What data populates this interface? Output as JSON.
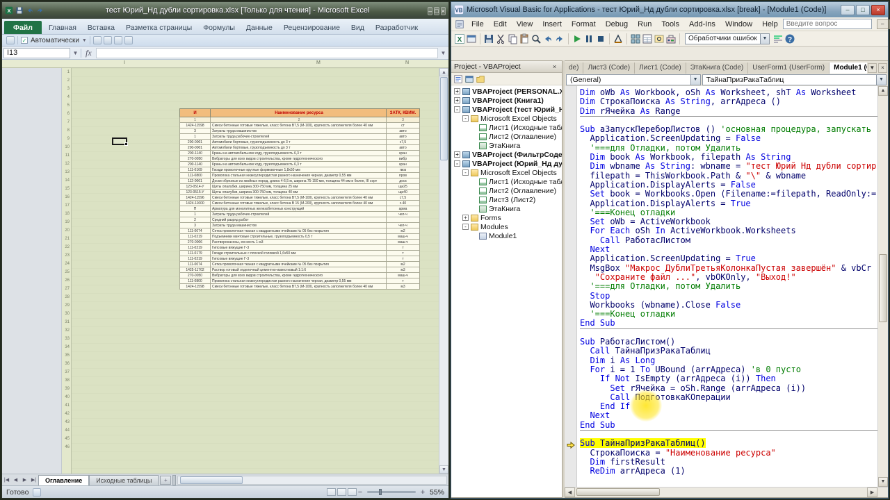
{
  "colors": {
    "excel_file_tab": "#217346",
    "sheet_fill": "#dbe2c3",
    "table_header_fill": "#f2bd7e",
    "table_header_text": "#c00000",
    "vba_keyword": "#0000e0",
    "vba_comment": "#007c00",
    "vba_string": "#cc0000",
    "vba_normal": "#00006b",
    "execution_highlight": "#ffff00"
  },
  "excel": {
    "window_title": "тест Юрий_Нд дубли сортировка.xlsx  [Только для чтения] - Microsoft Excel",
    "quick_access_icons": [
      "excel-logo-icon",
      "save-icon",
      "undo-icon",
      "redo-icon"
    ],
    "window_buttons": [
      "minimize-icon",
      "maximize-icon",
      "close-icon"
    ],
    "ribbon_tabs": [
      {
        "label": "Файл",
        "file": true
      },
      {
        "label": "Главная"
      },
      {
        "label": "Вставка"
      },
      {
        "label": "Разметка страницы"
      },
      {
        "label": "Формулы"
      },
      {
        "label": "Данные"
      },
      {
        "label": "Рецензирование"
      },
      {
        "label": "Вид"
      },
      {
        "label": "Разработчик"
      }
    ],
    "ribbon_bar": {
      "checkbox_label": "Автоматически",
      "icons": [
        "calc-options-icon",
        "grid-icon",
        "trace-icon",
        "watch-icon"
      ]
    },
    "formula_bar": {
      "name_box": "I13",
      "fx_label": "fx",
      "formula_value": ""
    },
    "grid": {
      "column_letters": [
        "I",
        "M",
        "N"
      ],
      "row_number_count": 46,
      "selection_cell": "I13"
    },
    "table": {
      "header": [
        "И",
        "Наименование ресурса",
        "ЗАТК, КВИМ."
      ],
      "subheader": [
        "1",
        "2",
        "3"
      ],
      "rows": [
        [
          "1424-11598",
          "Смеси бетонные готовые тяжелые, класс бетона В7,5 (М-100), крупность заполнителя более 40 мм",
          "ст"
        ],
        [
          "3",
          "Затраты труда машинистов",
          "авто"
        ],
        [
          "1",
          "Затраты труда рабочих-строителей",
          "авто"
        ],
        [
          "200-0001",
          "Автомобили бортовые, грузоподъемность до 3 т",
          "с7,5"
        ],
        [
          "200-0001",
          "Автомобили бортовые, грузоподъемность до 3 т",
          "авто"
        ],
        [
          "200-1140",
          "Краны на автомобильном ходу, грузоподъемность 6,3 т",
          "кран"
        ],
        [
          "270-0050",
          "Вибраторы для всех видов строительства, кроме гидротехнического",
          "вибр"
        ],
        [
          "200-1140",
          "Краны на автомобильном ходу, грузоподъемность 6,3 т",
          "кран"
        ],
        [
          "111-0169",
          "Гвозди проволочные круглые формовочные 1,8х50 мм",
          "гвоз"
        ],
        [
          "111-0800",
          "Проволока стальная низкоуглеродистая разного назначения черная, диаметр 0,55 мм",
          "пров"
        ],
        [
          "112-0061",
          "Доски обрезные из хвойных пород, длина 4-6,5 м, ширина 75-150 мм, толщина 44 мм и более, III сорт",
          "доск"
        ],
        [
          "123-0514-У",
          "Щиты опалубки, ширина 300-750 мм, толщина 25 мм",
          "щи25"
        ],
        [
          "123-0515-У",
          "Щиты опалубки, ширина 300-750 мм, толщина 40 мм",
          "щи40"
        ],
        [
          "1424-11596",
          "Смеси бетонные готовые тяжелые, класс бетона В7,5 (М-100), крупность заполнителя более 40 мм",
          "с7,5"
        ],
        [
          "1424-11600",
          "Смеси бетонные готовые тяжелые, класс бетона В 15 (М-200), крупность заполнителя более 40 мм",
          "с.40"
        ],
        [
          "П",
          "Арматура для монолитных железобетонных конструкций",
          "арма"
        ],
        [
          "1",
          "Затраты труда рабочих-строителей",
          "чел-ч"
        ],
        [
          "2",
          "Средний разряд работ",
          ""
        ],
        [
          "3",
          "Затраты труда машинистов",
          "чел-ч"
        ],
        [
          "111-0074",
          "Сетка проволочная тканая с квадратными ячейками № 05 без покрытия",
          "м2"
        ],
        [
          "111-0219",
          "Подъемники мачтовые строительные, грузоподъемность 0,5 т",
          "маш-ч"
        ],
        [
          "270-0006",
          "Растворонасосы, ем-кость 1 м3",
          "маш-ч"
        ],
        [
          "111-0219",
          "Гипсовые вяжущие Г-3",
          "т"
        ],
        [
          "111-0179",
          "Гвозди строительные с плоской головкой 1,6х50 мм",
          "т"
        ],
        [
          "111-0219",
          "Гипсовые вяжущие Г-3",
          "т"
        ],
        [
          "111-0074",
          "Сетка проволочная тканая с квадратными ячейками № 05 без покрытия",
          "м2"
        ],
        [
          "1425-11702",
          "Раствор готовый отделочный цементно-известковый 1:1:6",
          "м3"
        ],
        [
          "270-0050",
          "Вибраторы для всех видов строительства, кроме гидротехнического",
          "маш-ч"
        ],
        [
          "111-0800",
          "Проволока стальная низкоуглеродистая разного назначения черная, диаметр 0,55 мм",
          "т"
        ],
        [
          "1424-11598",
          "Смеси бетонные готовые тяжелые, класс бетона В7,5 (М-100), крупность заполнителя более 40 мм",
          "м3"
        ]
      ]
    },
    "sheet_tabs": [
      {
        "label": "Оглавление",
        "active": true
      },
      {
        "label": "Исходные таблицы",
        "active": false
      }
    ],
    "status_bar": {
      "mode": "Готово",
      "zoom": "55%",
      "view_icons": [
        "normal-view-icon",
        "page-layout-view-icon",
        "page-break-view-icon"
      ]
    }
  },
  "vba": {
    "window_title": "Microsoft Visual Basic for Applications - тест Юрий_Нд дубли сортировка.xlsx [break] - [Module1 (Code)]",
    "menus": [
      "File",
      "Edit",
      "View",
      "Insert",
      "Format",
      "Debug",
      "Run",
      "Tools",
      "Add-Ins",
      "Window",
      "Help"
    ],
    "question_box": "Введите вопрос",
    "window_buttons": [
      "minimize-icon",
      "restore-icon",
      "close-icon"
    ],
    "toolbar": {
      "icons_left": [
        "excel-view-icon",
        "insert-userform-icon",
        "save-icon",
        "cut-icon",
        "copy-icon",
        "paste-icon",
        "find-icon",
        "undo-icon",
        "redo-icon",
        "run-icon",
        "break-icon",
        "reset-icon",
        "design-mode-icon",
        "project-explorer-icon",
        "properties-window-icon",
        "object-browser-icon",
        "toolbox-icon"
      ],
      "combo_value": "Обработчики ошибок",
      "icons_right": [
        "comment-block-icon",
        "help-icon"
      ]
    },
    "project_panel": {
      "title": "Project - VBAProject",
      "toolbar_icons": [
        "view-code-icon",
        "view-object-icon",
        "toggle-folders-icon"
      ],
      "tree": [
        {
          "label": "VBAProject (PERSONAL.XLSB)",
          "level": 0,
          "bold": true,
          "icon": "project-icon",
          "exp": "+"
        },
        {
          "label": "VBAProject (Книга1)",
          "level": 0,
          "bold": true,
          "icon": "project-icon",
          "exp": "+"
        },
        {
          "label": "VBAProject (тест Юрий_Нд д",
          "level": 0,
          "bold": true,
          "icon": "project-icon",
          "exp": "-"
        },
        {
          "label": "Microsoft Excel Objects",
          "level": 1,
          "icon": "folder-icon",
          "exp": "-"
        },
        {
          "label": "Лист1 (Исходные таблиц",
          "level": 2,
          "icon": "sheet-icon"
        },
        {
          "label": "Лист2 (Оглавление)",
          "level": 2,
          "icon": "sheet-icon"
        },
        {
          "label": "ЭтаКнига",
          "level": 2,
          "icon": "workbook-icon"
        },
        {
          "label": "VBAProject (ФильтрСодержи",
          "level": 0,
          "bold": true,
          "icon": "project-icon",
          "exp": "+"
        },
        {
          "label": "VBAProject (Юрий_Нд дубли",
          "level": 0,
          "bold": true,
          "icon": "project-icon",
          "exp": "-"
        },
        {
          "label": "Microsoft Excel Objects",
          "level": 1,
          "icon": "folder-icon",
          "exp": "-"
        },
        {
          "label": "Лист1 (Исходные таблицы)",
          "level": 2,
          "icon": "sheet-icon"
        },
        {
          "label": "Лист2 (Оглавление)",
          "level": 2,
          "icon": "sheet-icon"
        },
        {
          "label": "Лист3 (Лист2)",
          "level": 2,
          "icon": "sheet-icon"
        },
        {
          "label": "ЭтаКнига",
          "level": 2,
          "icon": "workbook-icon"
        },
        {
          "label": "Forms",
          "level": 1,
          "icon": "folder-icon",
          "exp": "+"
        },
        {
          "label": "Modules",
          "level": 1,
          "icon": "folder-icon",
          "exp": "-"
        },
        {
          "label": "Module1",
          "level": 2,
          "icon": "module-icon"
        }
      ]
    },
    "code_window": {
      "tabs": [
        {
          "label": "de)"
        },
        {
          "label": "Лист3 (Code)"
        },
        {
          "label": "Лист1 (Code)"
        },
        {
          "label": "ЭтаКнига (Code)"
        },
        {
          "label": "UserForm1 (UserForm)"
        },
        {
          "label": "Module1 (Code)",
          "active": true
        }
      ],
      "object_combo": "(General)",
      "procedure_combo": "ТайнаПризРакаТаблиц",
      "lines": [
        {
          "s": [
            [
              "k",
              "Dim "
            ],
            [
              "n",
              "oWb "
            ],
            [
              "k",
              "As "
            ],
            [
              "n",
              "Workbook, oSh "
            ],
            [
              "k",
              "As "
            ],
            [
              "n",
              "Worksheet, shT "
            ],
            [
              "k",
              "As "
            ],
            [
              "n",
              "Worksheet"
            ]
          ]
        },
        {
          "s": [
            [
              "k",
              "Dim "
            ],
            [
              "n",
              "СтрокаПоиска "
            ],
            [
              "k",
              "As String"
            ],
            [
              "n",
              ", arrАдреса ()"
            ]
          ]
        },
        {
          "s": [
            [
              "k",
              "Dim "
            ],
            [
              "n",
              "rЯчейка "
            ],
            [
              "k",
              "As "
            ],
            [
              "n",
              "Range"
            ]
          ]
        },
        {
          "sep": true,
          "s": []
        },
        {
          "s": [
            [
              "k",
              "Sub "
            ],
            [
              "n",
              "аЗапускПереборЛистов () "
            ],
            [
              "c",
              "'основная процедура, запускать"
            ]
          ]
        },
        {
          "s": [
            [
              "n",
              "  Application.ScreenUpdating = "
            ],
            [
              "k",
              "False"
            ]
          ]
        },
        {
          "s": [
            [
              "c",
              "  '===для Отладки, потом Удалить"
            ]
          ]
        },
        {
          "s": [
            [
              "k",
              "  Dim "
            ],
            [
              "n",
              "book "
            ],
            [
              "k",
              "As "
            ],
            [
              "n",
              "Workbook, filepath "
            ],
            [
              "k",
              "As String"
            ]
          ]
        },
        {
          "s": [
            [
              "k",
              "  Dim "
            ],
            [
              "n",
              "wbname "
            ],
            [
              "k",
              "As String"
            ],
            [
              "n",
              ": wbname = "
            ],
            [
              "s",
              "\"тест Юрий Нд дубли сортир"
            ]
          ]
        },
        {
          "s": [
            [
              "n",
              "  filepath = ThisWorkbook.Path & "
            ],
            [
              "s",
              "\"\\\""
            ],
            [
              "n",
              " & wbname"
            ]
          ]
        },
        {
          "s": [
            [
              "n",
              "  Application.DisplayAlerts = "
            ],
            [
              "k",
              "False"
            ]
          ]
        },
        {
          "s": [
            [
              "k",
              "  Set "
            ],
            [
              "n",
              "book = Workbooks.Open (Filename:=filepath, ReadOnly:="
            ]
          ]
        },
        {
          "s": [
            [
              "n",
              "  Application.DisplayAlerts = "
            ],
            [
              "k",
              "True"
            ]
          ]
        },
        {
          "s": [
            [
              "c",
              "  '===Конец отладки"
            ]
          ]
        },
        {
          "s": [
            [
              "k",
              "  Set "
            ],
            [
              "n",
              "oWb = ActiveWorkbook"
            ]
          ]
        },
        {
          "s": [
            [
              "k",
              "  For Each "
            ],
            [
              "n",
              "oSh "
            ],
            [
              "k",
              "In "
            ],
            [
              "n",
              "ActiveWorkbook.Worksheets"
            ]
          ]
        },
        {
          "s": [
            [
              "k",
              "    Call "
            ],
            [
              "n",
              "РаботасЛистом"
            ]
          ]
        },
        {
          "s": [
            [
              "k",
              "  Next"
            ]
          ]
        },
        {
          "s": [
            [
              "n",
              "  Application.ScreenUpdating = "
            ],
            [
              "k",
              "True"
            ]
          ]
        },
        {
          "s": [
            [
              "n",
              "  MsgBox "
            ],
            [
              "s",
              "\"Макрос ДублиТретьяКолонкаПустая завершён\""
            ],
            [
              "n",
              " & vbCr"
            ]
          ]
        },
        {
          "s": [
            [
              "n",
              "   "
            ],
            [
              "s",
              "\"Сохраните файл ...\""
            ],
            [
              "n",
              ", vbOKOnly, "
            ],
            [
              "s",
              "\"Выход!\""
            ]
          ]
        },
        {
          "s": [
            [
              "c",
              "  '===для Отладки, потом Удалить"
            ]
          ]
        },
        {
          "s": [
            [
              "k",
              "  Stop"
            ]
          ]
        },
        {
          "s": [
            [
              "n",
              "  Workbooks (wbname).Close "
            ],
            [
              "k",
              "False"
            ]
          ]
        },
        {
          "s": [
            [
              "c",
              "  '===Конец отладки"
            ]
          ]
        },
        {
          "s": [
            [
              "k",
              "End Sub"
            ]
          ]
        },
        {
          "sep": true,
          "s": []
        },
        {
          "s": [
            [
              "k",
              "Sub "
            ],
            [
              "n",
              "РаботасЛистом()"
            ]
          ]
        },
        {
          "s": [
            [
              "k",
              "  Call "
            ],
            [
              "n",
              "ТайнаПризРакаТаблиц"
            ]
          ]
        },
        {
          "s": [
            [
              "k",
              "  Dim "
            ],
            [
              "n",
              "i "
            ],
            [
              "k",
              "As Long"
            ]
          ]
        },
        {
          "s": [
            [
              "k",
              "  For "
            ],
            [
              "n",
              "i = 1 "
            ],
            [
              "k",
              "To "
            ],
            [
              "n",
              "UBound (arrАдреса) "
            ],
            [
              "c",
              "'в 0 пусто"
            ]
          ]
        },
        {
          "s": [
            [
              "k",
              "    If Not "
            ],
            [
              "n",
              "IsEmpty (arrАдреса (i)) "
            ],
            [
              "k",
              "Then"
            ]
          ]
        },
        {
          "s": [
            [
              "k",
              "      Set "
            ],
            [
              "n",
              "rЯчейка = oSh.Range (arrАдреса (i))"
            ]
          ]
        },
        {
          "s": [
            [
              "k",
              "      Call "
            ],
            [
              "n",
              "ПодготовкаКОперации"
            ]
          ]
        },
        {
          "s": [
            [
              "k",
              "    End If"
            ]
          ]
        },
        {
          "s": [
            [
              "k",
              "  Next"
            ]
          ]
        },
        {
          "s": [
            [
              "k",
              "End Sub"
            ]
          ]
        },
        {
          "sep": true,
          "s": []
        },
        {
          "hl": true,
          "arrow": true,
          "s": [
            [
              "k",
              "Sub "
            ],
            [
              "n",
              "ТайнаПризРакаТаблиц()"
            ]
          ]
        },
        {
          "s": [
            [
              "n",
              "  СтрокаПоиска = "
            ],
            [
              "s",
              "\"Наименование ресурса\""
            ]
          ]
        },
        {
          "s": [
            [
              "k",
              "  Dim "
            ],
            [
              "n",
              "firstResult"
            ]
          ]
        },
        {
          "s": [
            [
              "k",
              "  ReDim "
            ],
            [
              "n",
              "arrАдреса (1)"
            ]
          ]
        }
      ]
    }
  }
}
